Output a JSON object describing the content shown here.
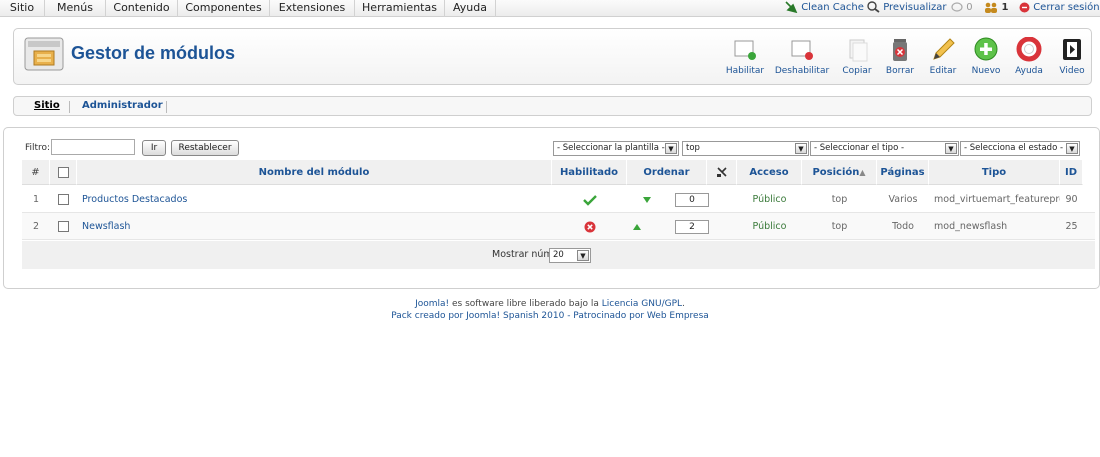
{
  "topmenu": {
    "items": [
      "Sitio",
      "Menús",
      "Contenido",
      "Componentes",
      "Extensiones",
      "Herramientas",
      "Ayuda"
    ],
    "clean_cache": "Clean Cache",
    "preview": "Previsualizar",
    "messages_count": "0",
    "users_count": "1",
    "logout": "Cerrar sesión"
  },
  "header": {
    "title": "Gestor de módulos",
    "toolbar": [
      "Habilitar",
      "Deshabilitar",
      "Copiar",
      "Borrar",
      "Editar",
      "Nuevo",
      "Ayuda",
      "Video"
    ]
  },
  "subtabs": {
    "site": "Sitio",
    "admin": "Administrador"
  },
  "filter": {
    "label": "Filtro:",
    "value": "",
    "go": "Ir",
    "reset": "Restablecer",
    "template_select": "- Seleccionar la plantilla -",
    "position_select": "top",
    "type_select": "- Seleccionar el tipo -",
    "state_select": "- Selecciona el estado -"
  },
  "table": {
    "headers": {
      "num": "#",
      "name": "Nombre del módulo",
      "enabled": "Habilitado",
      "order": "Ordenar",
      "access": "Acceso",
      "position": "Posición",
      "pages": "Páginas",
      "type": "Tipo",
      "id": "ID"
    },
    "rows": [
      {
        "num": "1",
        "name": "Productos Destacados",
        "enabled": "yes",
        "order": "0",
        "access": "Público",
        "position": "top",
        "pages": "Varios",
        "type": "mod_virtuemart_featureprod",
        "id": "90"
      },
      {
        "num": "2",
        "name": "Newsflash",
        "enabled": "no",
        "order": "2",
        "access": "Público",
        "position": "top",
        "pages": "Todo",
        "type": "mod_newsflash",
        "id": "25"
      }
    ],
    "display_num_label": "Mostrar núm.",
    "display_num_value": "20"
  },
  "footer": {
    "joomla": "Joomla!",
    "line1_mid": " es software libre liberado bajo la ",
    "license": "Licencia GNU/GPL",
    "line1_end": ".",
    "line2": "Pack creado por Joomla! Spanish 2010 - Patrocinado por Web Empresa"
  },
  "colors": {
    "link": "#1d5496",
    "enabled": "#3aa53a",
    "disabled": "#d9343a"
  }
}
